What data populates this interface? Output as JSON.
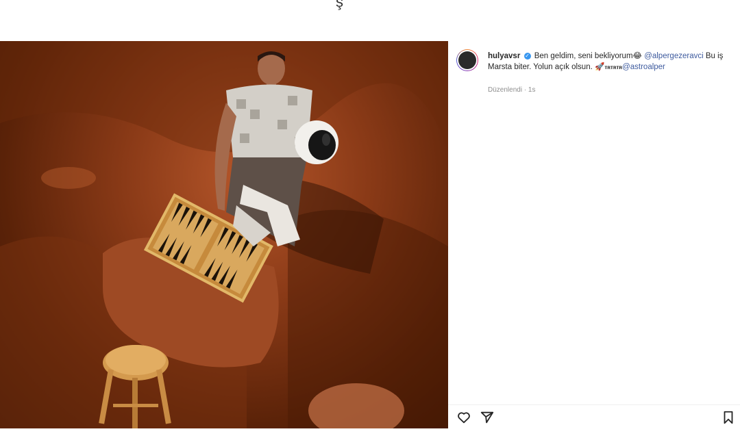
{
  "top_fragment": "ş",
  "post": {
    "username": "hulyavsr",
    "caption_parts": {
      "text1": "Ben geldim, seni bekliyorum😂",
      "mention1": "@alpergezeravci",
      "text2": "Bu iş Marsta biter. Yolun açık olsun. 🚀",
      "text3": "ᴛʀᴛʀᴛʀ",
      "mention2": "@astroalper"
    },
    "meta": "Düzenlendi · 1s"
  },
  "icons": {
    "verified": "verified-badge-icon",
    "like": "heart-icon",
    "share": "paper-plane-icon",
    "save": "bookmark-icon"
  }
}
